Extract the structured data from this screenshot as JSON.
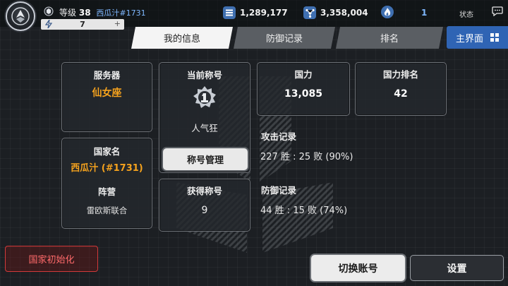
{
  "header": {
    "level_label": "等级",
    "level": "38",
    "player_name": "西瓜汁#1731",
    "energy": "7",
    "energy_plus": "+",
    "resources": [
      {
        "icon": "stack-icon",
        "value": "1,289,177"
      },
      {
        "icon": "molecule-icon",
        "value": "3,358,004"
      },
      {
        "icon": "flame-icon",
        "value": "1"
      }
    ],
    "status_label": "状态",
    "colors": {
      "accent_blue": "#2f64b4",
      "orange": "#f5a21d",
      "danger": "#d23a3a"
    }
  },
  "tabs": [
    {
      "label": "我的信息",
      "active": true
    },
    {
      "label": "防御记录",
      "active": false
    },
    {
      "label": "排名",
      "active": false
    }
  ],
  "home_button": {
    "label": "主界面"
  },
  "info": {
    "server_label": "服务器",
    "server_value": "仙女座",
    "country_label": "国家名",
    "country_value": "西瓜汁 (#1731)",
    "faction_label": "阵营",
    "faction_value": "雷欧斯联合",
    "current_title_label": "当前称号",
    "current_title_value": "人气狂",
    "title_manage_label": "称号管理",
    "gained_titles_label": "获得称号",
    "gained_titles_value": "9",
    "power_label": "国力",
    "power_value": "13,085",
    "power_rank_label": "国力排名",
    "power_rank_value": "42"
  },
  "records": {
    "attack_label": "攻击记录",
    "attack_value": "227 胜 : 25 败 (90%)",
    "defense_label": "防御记录",
    "defense_value": "44 胜 : 15 败 (74%)"
  },
  "buttons": {
    "reset_country": "国家初始化",
    "switch_account": "切换账号",
    "settings": "设置"
  }
}
